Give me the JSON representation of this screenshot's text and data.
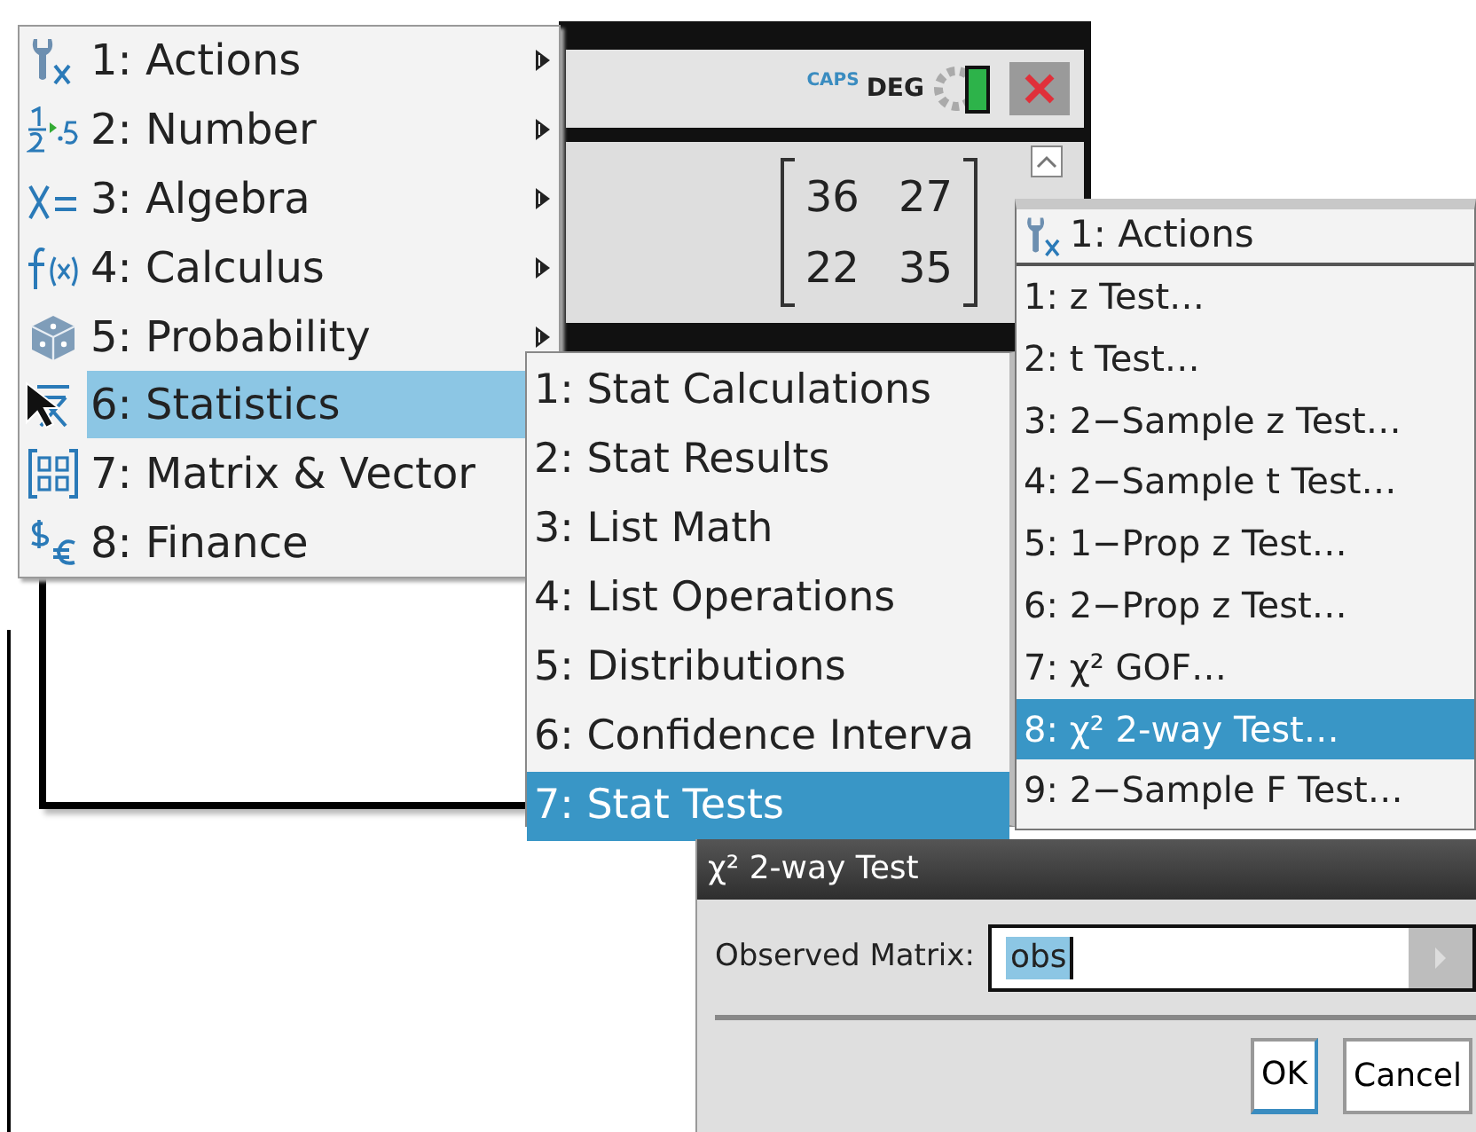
{
  "calculator": {
    "indicators": [
      {
        "text": "CAPS",
        "kind": "caps"
      },
      {
        "text": "DEG",
        "kind": "mode"
      }
    ],
    "matrix": [
      [
        "36",
        "27"
      ],
      [
        "22",
        "35"
      ]
    ]
  },
  "main_menu": {
    "items": [
      {
        "label": "1: Actions",
        "has_submenu": true,
        "selected": false
      },
      {
        "label": "2: Number",
        "has_submenu": true,
        "selected": false
      },
      {
        "label": "3: Algebra",
        "has_submenu": true,
        "selected": false
      },
      {
        "label": "4: Calculus",
        "has_submenu": true,
        "selected": false
      },
      {
        "label": "5: Probability",
        "has_submenu": true,
        "selected": false
      },
      {
        "label": "6: Statistics",
        "selected": true
      },
      {
        "label": "7: Matrix & Vector",
        "selected": false
      },
      {
        "label": "8: Finance",
        "selected": false
      }
    ]
  },
  "statistics_menu": {
    "items": [
      {
        "label": "1: Stat Calculations",
        "selected": false
      },
      {
        "label": "2: Stat Results",
        "selected": false
      },
      {
        "label": "3: List Math",
        "selected": false
      },
      {
        "label": "4: List Operations",
        "selected": false
      },
      {
        "label": "5: Distributions",
        "selected": false
      },
      {
        "label": "6: Confidence Interva",
        "selected": false
      },
      {
        "label": "7: Stat Tests",
        "selected": true
      }
    ]
  },
  "stat_tests_menu": {
    "header": "1: Actions",
    "items": [
      {
        "label": "1: z Test…",
        "selected": false
      },
      {
        "label": "2: t Test…",
        "selected": false
      },
      {
        "label": "3: 2−Sample z Test…",
        "selected": false
      },
      {
        "label": "4: 2−Sample t Test…",
        "selected": false
      },
      {
        "label": "5: 1−Prop z Test…",
        "selected": false
      },
      {
        "label": "6: 2−Prop z Test…",
        "selected": false
      },
      {
        "label": "7: χ² GOF…",
        "selected": false
      },
      {
        "label": "8: χ² 2-way Test…",
        "selected": true
      },
      {
        "label": "9: 2−Sample F Test…",
        "selected": false
      }
    ]
  },
  "dialog": {
    "title": "χ² 2-way Test",
    "field_label": "Observed Matrix:",
    "field_value": "obs",
    "value_selected": true,
    "buttons": [
      {
        "label": "OK",
        "focused": true
      },
      {
        "label": "Cancel",
        "focused": false
      }
    ]
  }
}
